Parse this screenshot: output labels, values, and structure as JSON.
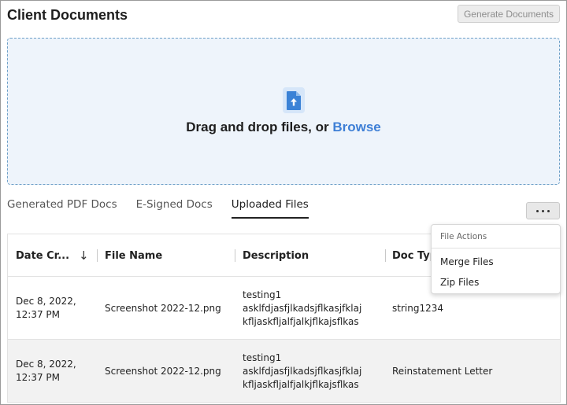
{
  "header": {
    "title": "Client Documents",
    "generate_button": "Generate Documents"
  },
  "dropzone": {
    "text": "Drag and drop files, or ",
    "browse_label": "Browse",
    "icon": "file-upload-icon",
    "accent_color": "#3e7fd6"
  },
  "tabs": [
    {
      "label": "Generated PDF Docs",
      "active": false
    },
    {
      "label": "E-Signed Docs",
      "active": false
    },
    {
      "label": "Uploaded Files",
      "active": true
    }
  ],
  "more_button": {
    "icon": "more-horizontal-icon"
  },
  "table": {
    "columns": [
      {
        "label": "Date Cr...",
        "sort": "descending"
      },
      {
        "label": "File Name"
      },
      {
        "label": "Description"
      },
      {
        "label": "Doc Typ"
      }
    ],
    "rows": [
      {
        "date": "Dec 8, 2022,\n12:37 PM",
        "file_name": "Screenshot 2022-12.png",
        "description": "testing1\nasklfdjasfjlkadsjflkasjfklaj\nkfljaskfljalfjalkjflkajsflkas",
        "doc_type": "string1234"
      },
      {
        "date": "Dec 8, 2022,\n12:37 PM",
        "file_name": "Screenshot 2022-12.png",
        "description": "testing1\nasklfdjasfjlkadsjflkasjfklaj\nkfljaskfljalfjalkjflkajsflkas",
        "doc_type": "Reinstatement Letter"
      }
    ]
  },
  "file_actions_menu": {
    "heading": "File Actions",
    "items": [
      "Merge Files",
      "Zip Files"
    ]
  }
}
